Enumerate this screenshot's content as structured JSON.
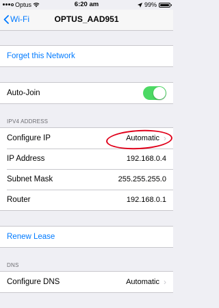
{
  "status_bar": {
    "carrier": "Optus",
    "time": "6:20 am",
    "battery": "99%",
    "battery_level": 0.99
  },
  "nav": {
    "back_label": "Wi-Fi",
    "title": "OPTUS_AAD951"
  },
  "actions": {
    "forget": "Forget this Network",
    "renew": "Renew Lease"
  },
  "auto_join": {
    "label": "Auto-Join",
    "enabled": true
  },
  "ipv4": {
    "header": "IPV4 ADDRESS",
    "configure_label": "Configure IP",
    "configure_value": "Automatic",
    "ip_label": "IP Address",
    "ip_value": "192.168.0.4",
    "mask_label": "Subnet Mask",
    "mask_value": "255.255.255.0",
    "router_label": "Router",
    "router_value": "192.168.0.1"
  },
  "dns": {
    "header": "DNS",
    "configure_label": "Configure DNS",
    "configure_value": "Automatic"
  },
  "colors": {
    "accent": "#007aff",
    "toggle_on": "#4cd964",
    "annotation": "#e0001a"
  }
}
